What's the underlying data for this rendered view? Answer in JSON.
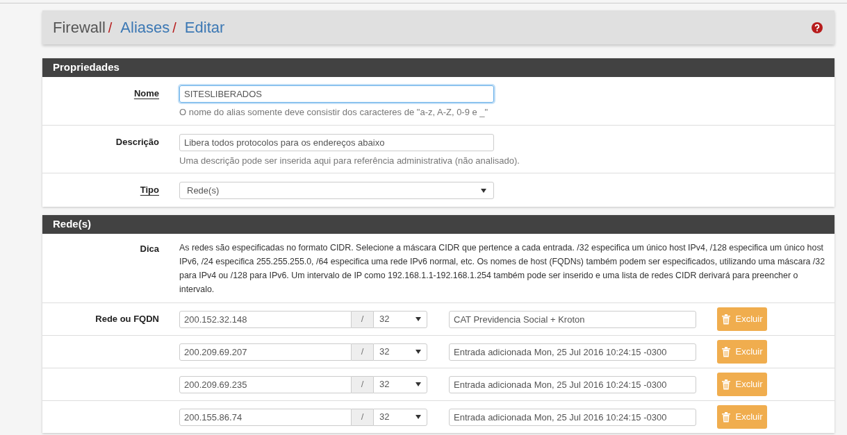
{
  "breadcrumb": [
    {
      "text": "Firewall",
      "link": false
    },
    {
      "separator": "/",
      "text": "Aliases",
      "link": true
    },
    {
      "separator": "/",
      "text": "Editar",
      "link": true
    }
  ],
  "properties": {
    "title": "Propriedades",
    "fields": [
      {
        "kind": "input",
        "label": "Nome",
        "required": true,
        "focused": true,
        "value": "SITESLIBERADOS",
        "help": "O nome do alias somente deve consistir dos caracteres de \"a-z, A-Z, 0-9 e _\""
      },
      {
        "kind": "input",
        "label": "Descrição",
        "required": false,
        "focused": false,
        "value": "Libera todos protocolos para os endereços abaixo",
        "help": "Uma descrição pode ser inserida aqui para referência administrativa (não analisado)."
      },
      {
        "kind": "select",
        "label": "Tipo",
        "required": true,
        "value": "Rede(s)"
      }
    ]
  },
  "networks": {
    "title": "Rede(s)",
    "hint_label": "Dica",
    "hint": "As redes são especificadas no formato CIDR. Selecione a máscara CIDR que pertence a cada entrada. /32 especifica um único host IPv4, /128 especifica um único host IPv6, /24 especifica 255.255.255.0, /64 especifica uma rede IPv6 normal, etc. Os nomes de host (FQDNs) também podem ser especificados, utilizando uma máscara /32 para IPv4 ou /128 para IPv6. Um intervalo de IP como 192.168.1.1-192.168.1.254 também pode ser inserido e uma lista de redes CIDR derivará para preencher o intervalo.",
    "rows_label": "Rede ou FQDN",
    "rows": [
      {
        "address": "200.152.32.148",
        "separator": "/",
        "mask": "32",
        "description": "CAT Previdencia Social + Kroton",
        "button": "Excluir"
      },
      {
        "address": "200.209.69.207",
        "separator": "/",
        "mask": "32",
        "description": "Entrada adicionada Mon, 25 Jul 2016 10:24:15 -0300",
        "button": "Excluir"
      },
      {
        "address": "200.209.69.235",
        "separator": "/",
        "mask": "32",
        "description": "Entrada adicionada Mon, 25 Jul 2016 10:24:15 -0300",
        "button": "Excluir"
      },
      {
        "address": "200.155.86.74",
        "separator": "/",
        "mask": "32",
        "description": "Entrada adicionada Mon, 25 Jul 2016 10:24:15 -0300",
        "button": "Excluir"
      }
    ]
  }
}
